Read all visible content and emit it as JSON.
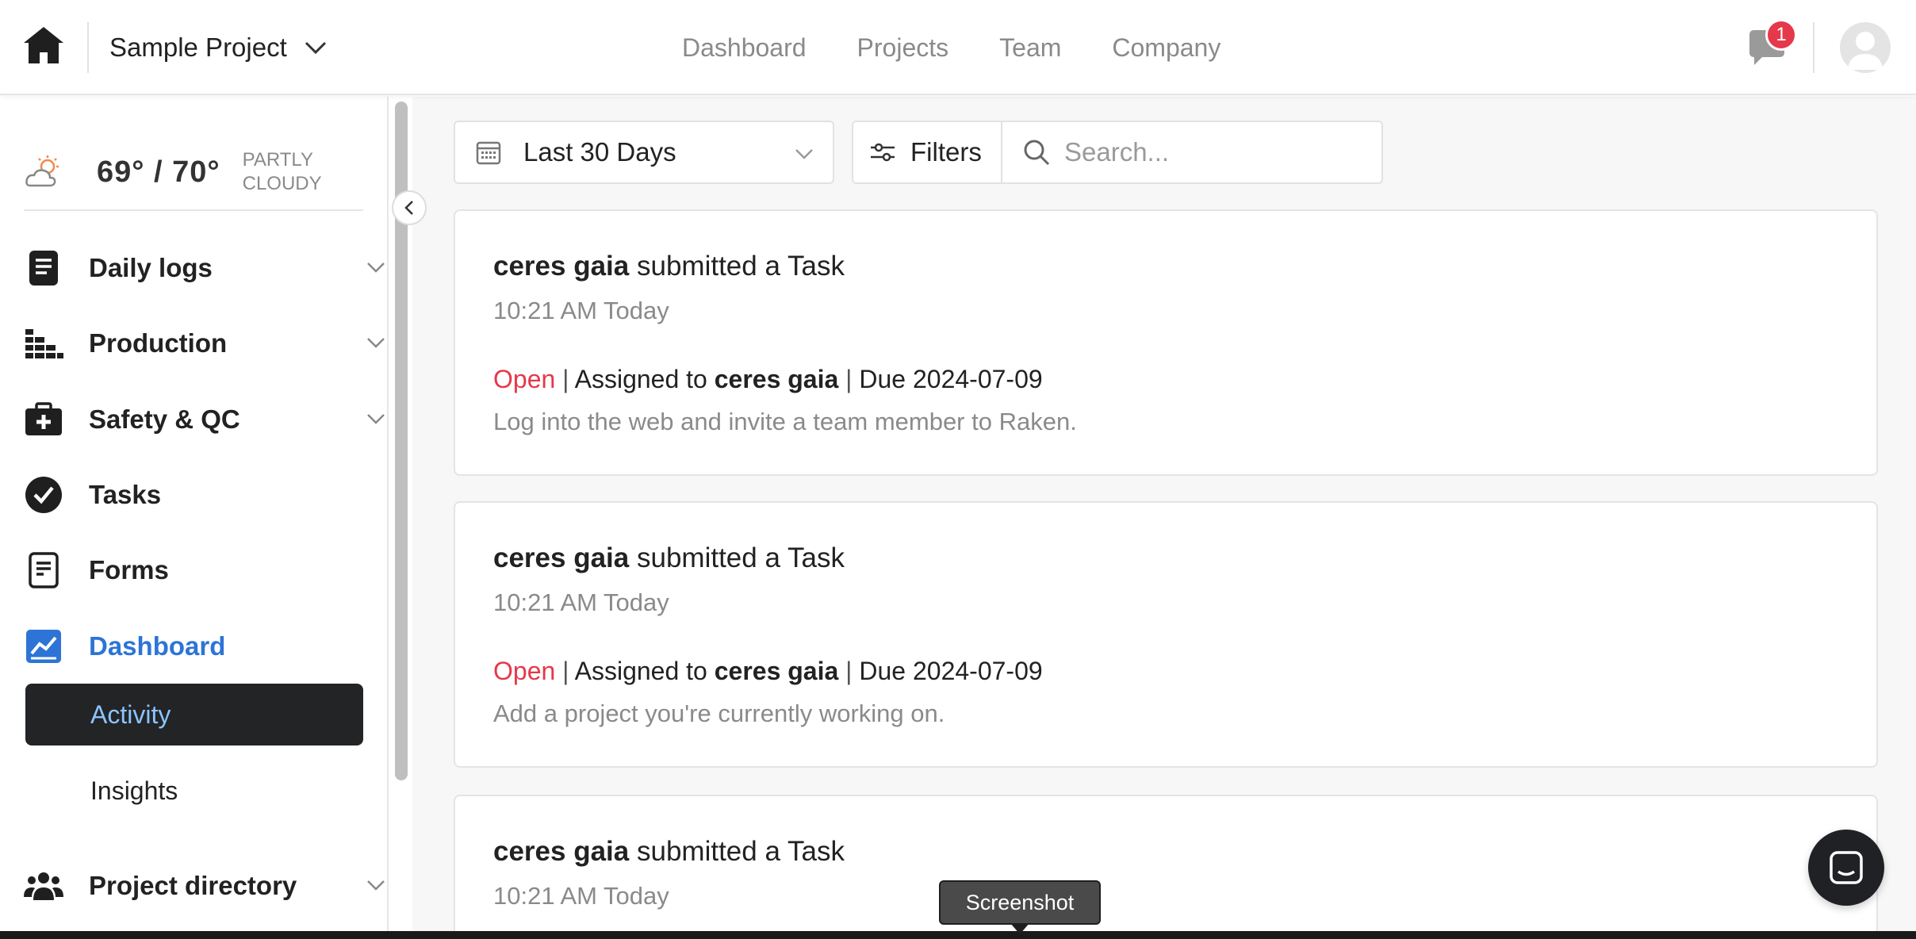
{
  "header": {
    "project_name": "Sample Project",
    "nav": [
      {
        "label": "Dashboard"
      },
      {
        "label": "Projects"
      },
      {
        "label": "Team"
      },
      {
        "label": "Company"
      }
    ],
    "notification_count": "1"
  },
  "weather": {
    "temp": "69° / 70°",
    "condition_line1": "PARTLY",
    "condition_line2": "CLOUDY"
  },
  "sidebar": {
    "items": [
      {
        "label": "Daily logs",
        "icon": "daily-logs-icon"
      },
      {
        "label": "Production",
        "icon": "production-icon"
      },
      {
        "label": "Safety & QC",
        "icon": "first-aid-kit-icon"
      },
      {
        "label": "Tasks",
        "icon": "check-circle-icon"
      },
      {
        "label": "Forms",
        "icon": "form-document-icon"
      },
      {
        "label": "Dashboard",
        "icon": "chart-icon"
      },
      {
        "label": "Project directory",
        "icon": "people-icon"
      }
    ],
    "subitems": [
      {
        "label": "Activity"
      },
      {
        "label": "Insights"
      }
    ]
  },
  "toolbar": {
    "date_range": "Last 30 Days",
    "filters_label": "Filters",
    "search_placeholder": "Search..."
  },
  "activity": [
    {
      "user": "ceres gaia",
      "action": "submitted a Task",
      "time": "10:21 AM Today",
      "status": "Open",
      "assigned_prefix": "Assigned to",
      "assignee": "ceres gaia",
      "due": "Due 2024-07-09",
      "description": "Log into the web and invite a team member to Raken."
    },
    {
      "user": "ceres gaia",
      "action": "submitted a Task",
      "time": "10:21 AM Today",
      "status": "Open",
      "assigned_prefix": "Assigned to",
      "assignee": "ceres gaia",
      "due": "Due 2024-07-09",
      "description": "Add a project you're currently working on."
    },
    {
      "user": "ceres gaia",
      "action": "submitted a Task",
      "time": "10:21 AM Today"
    }
  ],
  "tooltip": "Screenshot",
  "colors": {
    "accent": "#2d74d6",
    "status_open": "#e5384a",
    "active_bg": "#222426"
  }
}
